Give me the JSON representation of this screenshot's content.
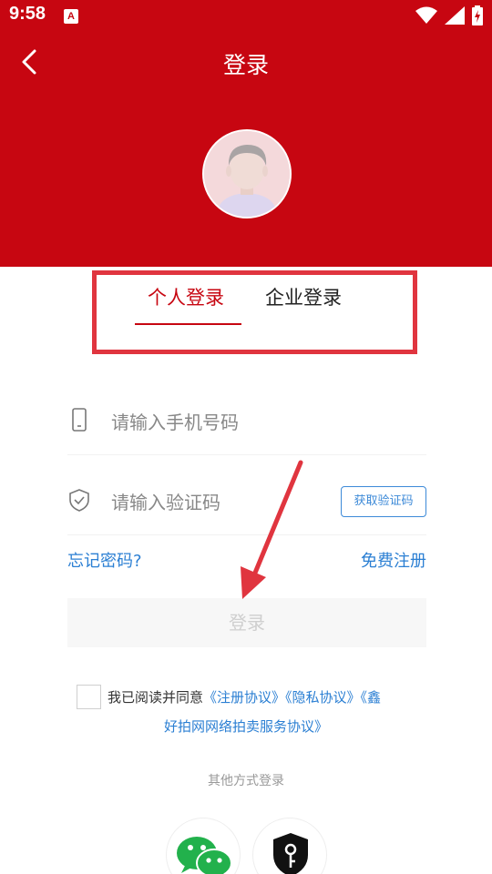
{
  "status_bar": {
    "time": "9:58",
    "notification_icon": "A"
  },
  "nav": {
    "back_icon": "chevron-left-icon",
    "title": "登录"
  },
  "tabs": [
    {
      "label": "个人登录",
      "active": true
    },
    {
      "label": "企业登录",
      "active": false
    }
  ],
  "form": {
    "phone_placeholder": "请输入手机号码",
    "code_placeholder": "请输入验证码",
    "get_code_label": "获取验证码",
    "forgot_label": "忘记密码?",
    "register_label": "免费注册",
    "login_label": "登录"
  },
  "agreement": {
    "prefix": "我已阅读并同意",
    "link1": "《注册协议》",
    "link2": "《隐私协议》",
    "link3_part1": "《鑫",
    "link3_part2": "好拍网网络拍卖服务协议》",
    "checked": false
  },
  "other": {
    "label": "其他方式登录",
    "methods": [
      "wechat-icon",
      "key-icon"
    ]
  },
  "colors": {
    "brand_red": "#c70611",
    "link_blue": "#2b7fd3",
    "annotation_red": "#e0353f"
  }
}
